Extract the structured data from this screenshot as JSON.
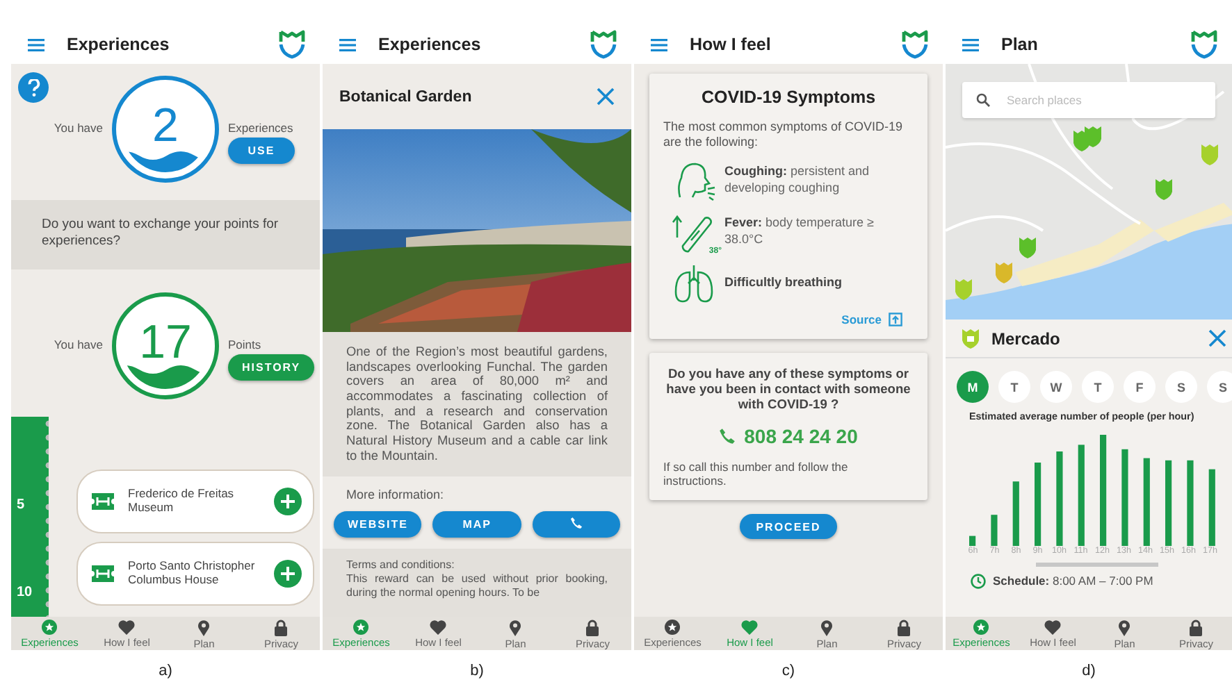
{
  "panels": [
    {
      "kind": "experiences",
      "caption": "a)",
      "title": "Experiences",
      "experiences": {
        "prefix": "You have",
        "value": "2",
        "suffix": "Experiences",
        "button": "USE"
      },
      "question": "Do you want to exchange your points for experiences?",
      "points": {
        "prefix": "You have",
        "value": "17",
        "suffix": "Points",
        "button": "HISTORY"
      },
      "timeline": {
        "markers": [
          "5",
          "10"
        ],
        "rewards": [
          "Frederico de Freitas Museum",
          "Porto Santo Christopher Columbus House"
        ]
      },
      "nav": [
        {
          "kind": "star",
          "label": "Experiences",
          "selected": true
        },
        {
          "kind": "heart",
          "label": "How I feel",
          "selected": false
        },
        {
          "kind": "pin",
          "label": "Plan",
          "selected": false
        },
        {
          "kind": "lock",
          "label": "Privacy",
          "selected": false
        }
      ]
    },
    {
      "kind": "detail",
      "caption": "b)",
      "title": "Experiences",
      "place": "Botanical Garden",
      "description": "One of the Region’s most beautiful gardens, landscapes overlooking Funchal. The garden covers an area of 80,000 m² and accommodates a fascinating collection of plants, and a research and conservation zone. The Botanical Garden also has a Natural History Museum and a cable car link to the Mountain.",
      "more_info": "More information:",
      "buttons": [
        {
          "kind": "text",
          "label": "WEBSITE"
        },
        {
          "kind": "text",
          "label": "MAP"
        },
        {
          "kind": "phone"
        }
      ],
      "terms_title": "Terms and conditions:",
      "terms": "This reward can be used without prior booking, during the normal opening hours. To be",
      "nav": [
        {
          "kind": "star",
          "label": "Experiences",
          "selected": true
        },
        {
          "kind": "heart",
          "label": "How I feel",
          "selected": false
        },
        {
          "kind": "pin",
          "label": "Plan",
          "selected": false
        },
        {
          "kind": "lock",
          "label": "Privacy",
          "selected": false
        }
      ]
    },
    {
      "kind": "symptoms",
      "caption": "c)",
      "title": "How I feel",
      "card_title": "COVID-19 Symptoms",
      "intro": "The most common symptoms of COVID-19 are the following:",
      "symptoms": [
        {
          "kind": "cough",
          "text": "**Coughing:** persistent and developing coughing"
        },
        {
          "kind": "fever",
          "badge": "38°",
          "text": "**Fever:** body temperature ≥ 38.0°C"
        },
        {
          "kind": "lungs",
          "text": "**Difficultly breathing**"
        }
      ],
      "source": "Source",
      "contact_question": "Do you have any of these symptoms or have you been in contact with someone with COVID-19 ?",
      "phone": "808 24 24 20",
      "contact_note": "If so call this number and follow the instructions.",
      "button": "PROCEED",
      "nav": [
        {
          "kind": "star",
          "label": "Experiences",
          "selected": false
        },
        {
          "kind": "heart",
          "label": "How I feel",
          "selected": true
        },
        {
          "kind": "pin",
          "label": "Plan",
          "selected": false
        },
        {
          "kind": "lock",
          "label": "Privacy",
          "selected": false
        }
      ]
    },
    {
      "kind": "plan",
      "caption": "d)",
      "title": "Plan",
      "search": {
        "placeholder": "Search places"
      },
      "place": "Mercado",
      "days": [
        {
          "label": "M",
          "selected": true
        },
        {
          "label": "T",
          "selected": false
        },
        {
          "label": "W",
          "selected": false
        },
        {
          "label": "T",
          "selected": false
        },
        {
          "label": "F",
          "selected": false
        },
        {
          "label": "S",
          "selected": false
        },
        {
          "label": "S",
          "selected": false
        }
      ],
      "chart_title": "Estimated average number of people (per hour)",
      "hours": [
        "6h",
        "7h",
        "8h",
        "9h",
        "10h",
        "11h",
        "12h",
        "13h",
        "14h",
        "15h",
        "16h",
        "17h"
      ],
      "schedule": "**Schedule:** 8:00 AM – 7:00 PM",
      "nav": [
        {
          "kind": "star",
          "label": "Experiences",
          "selected": true
        },
        {
          "kind": "heart",
          "label": "How I feel",
          "selected": false
        },
        {
          "kind": "pin",
          "label": "Plan",
          "selected": false
        },
        {
          "kind": "lock",
          "label": "Privacy",
          "selected": false
        }
      ]
    }
  ]
}
